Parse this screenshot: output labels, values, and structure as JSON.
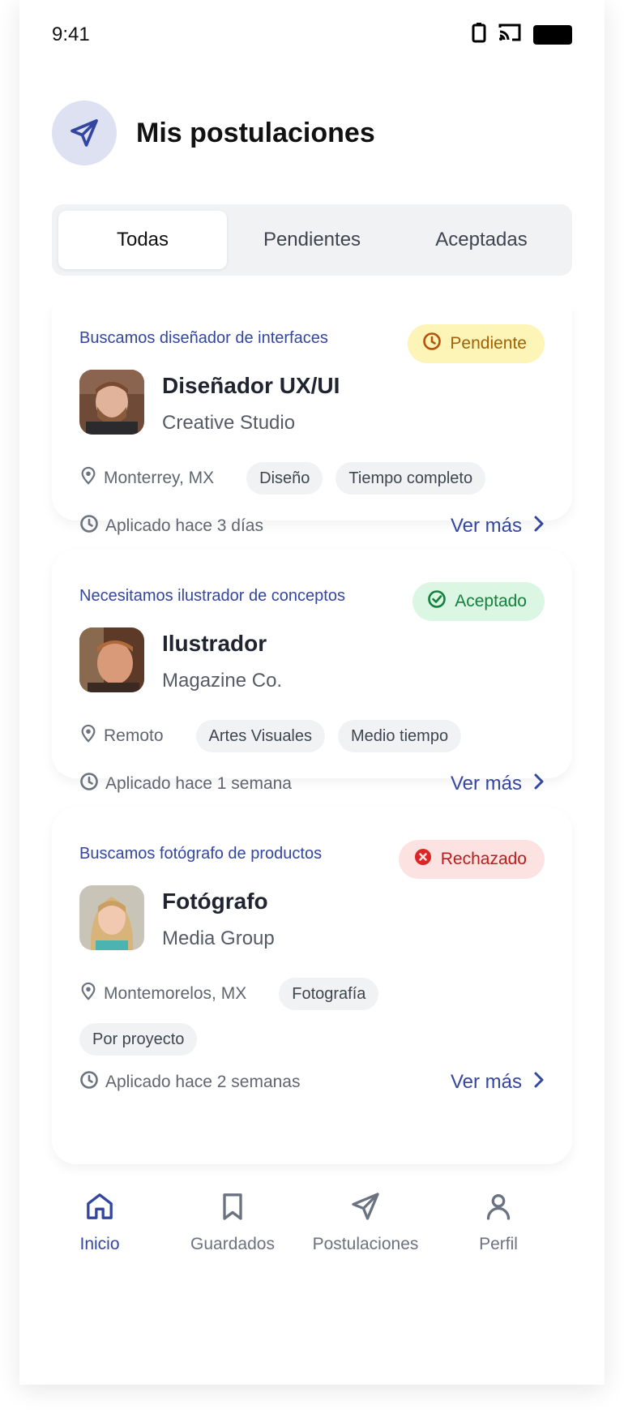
{
  "status_bar": {
    "time": "9:41"
  },
  "header": {
    "title": "Mis postulaciones",
    "icon": "send-icon"
  },
  "tabs": [
    {
      "label": "Todas",
      "active": true
    },
    {
      "label": "Pendientes",
      "active": false
    },
    {
      "label": "Aceptadas",
      "active": false
    }
  ],
  "applications": [
    {
      "tagline": "Buscamos diseñador de interfaces",
      "status": "Pendiente",
      "status_icon": "clock-icon",
      "status_color": "#a16207",
      "status_bg": "#fdf4b8",
      "job_title": "Diseñador UX/UI",
      "company": "Creative Studio",
      "location": "Monterrey, MX",
      "tags": [
        "Diseño",
        "Tiempo completo"
      ],
      "applied": "Aplicado hace 3 días",
      "cta": "Ver más"
    },
    {
      "tagline": "Necesitamos ilustrador de conceptos",
      "status": "Aceptado",
      "status_icon": "check-circle-icon",
      "status_color": "#15803d",
      "status_bg": "#dcf6e4",
      "job_title": "Ilustrador",
      "company": "Magazine Co.",
      "location": "Remoto",
      "tags": [
        "Artes Visuales",
        "Medio tiempo"
      ],
      "applied": "Aplicado hace 1 semana",
      "cta": "Ver más"
    },
    {
      "tagline": "Buscamos fotógrafo de productos",
      "status": "Rechazado",
      "status_icon": "x-circle-icon",
      "status_color": "#b91c1c",
      "status_bg": "#fde2e2",
      "job_title": "Fotógrafo",
      "company": "Media Group",
      "location": "Montemorelos, MX",
      "tags": [
        "Fotografía",
        "Por proyecto"
      ],
      "applied": "Aplicado hace 2 semanas",
      "cta": "Ver más"
    }
  ],
  "bottom_nav": [
    {
      "label": "Inicio",
      "icon": "home-icon",
      "active": true
    },
    {
      "label": "Guardados",
      "icon": "bookmark-icon",
      "active": false
    },
    {
      "label": "Postulaciones",
      "icon": "send-icon",
      "active": false
    },
    {
      "label": "Perfil",
      "icon": "user-icon",
      "active": false
    }
  ],
  "colors": {
    "accent": "#3346a0",
    "muted": "#6b7280",
    "chip_bg": "#f1f2f4"
  }
}
